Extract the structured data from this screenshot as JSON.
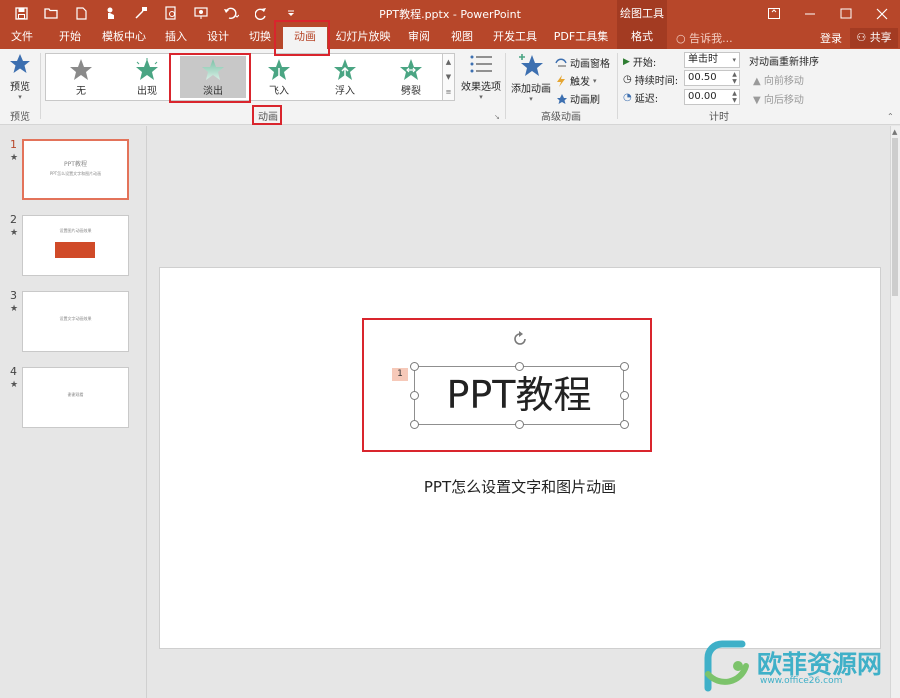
{
  "window": {
    "title": "PPT教程.pptx - PowerPoint",
    "context_tool": "绘图工具"
  },
  "tabs": [
    "文件",
    "开始",
    "模板中心",
    "插入",
    "设计",
    "切换",
    "动画",
    "幻灯片放映",
    "审阅",
    "视图",
    "开发工具",
    "PDF工具集",
    "格式"
  ],
  "active_tab": "动画",
  "tell_me": "告诉我...",
  "login": "登录",
  "share": "共享",
  "ribbon": {
    "preview": {
      "label": "预览",
      "group": "预览"
    },
    "animation_gallery": {
      "items": [
        "无",
        "出现",
        "淡出",
        "飞入",
        "浮入",
        "劈裂"
      ],
      "selected": "淡出",
      "group": "动画"
    },
    "effect_options": "效果选项",
    "advanced": {
      "add_animation": "添加动画",
      "pane": "动画窗格",
      "trigger": "触发",
      "painter": "动画刷",
      "group": "高级动画"
    },
    "timing": {
      "start_label": "开始:",
      "start_value": "单击时",
      "duration_label": "持续时间:",
      "duration_value": "00.50",
      "delay_label": "延迟:",
      "delay_value": "00.00",
      "reorder_title": "对动画重新排序",
      "move_earlier": "向前移动",
      "move_later": "向后移动",
      "group": "计时"
    }
  },
  "slides": [
    {
      "num": "1",
      "title": "PPT教程"
    },
    {
      "num": "2",
      "title": "设置图片动画效果"
    },
    {
      "num": "3",
      "title": "设置文字动画效果"
    },
    {
      "num": "4",
      "title": "谢谢观看"
    }
  ],
  "current_slide": {
    "title": "PPT教程",
    "subtitle": "PPT怎么设置文字和图片动画",
    "anim_tag": "1"
  },
  "watermark": {
    "text": "欧菲资源网",
    "url": "www.office26.com"
  },
  "colors": {
    "accent": "#b7472a",
    "highlight": "#d9252d",
    "star_green": "#4aa583"
  }
}
